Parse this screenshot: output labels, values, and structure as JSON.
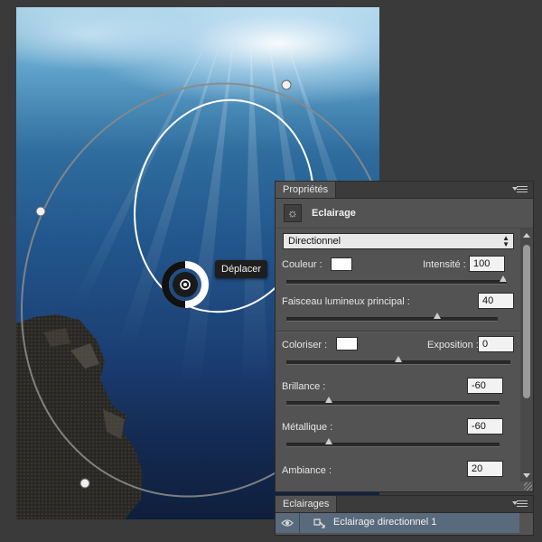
{
  "canvas": {
    "tooltip": "Déplacer"
  },
  "properties_panel": {
    "tab_label": "Propriétés",
    "header_icon": "sun-light-icon",
    "title": "Eclairage",
    "light_type": "Directionnel",
    "color_label": "Couleur :",
    "color_value": "#ffffff",
    "intensity_label": "Intensité :",
    "intensity_value": "100",
    "intensity_slider": 100,
    "hotspot_label": "Faisceau lumineux principal :",
    "hotspot_value": "40",
    "hotspot_slider": 40,
    "colorize_label": "Coloriser :",
    "colorize_value": "#ffffff",
    "exposure_label": "Exposition :",
    "exposure_value": "0",
    "exposure_slider": 0,
    "gloss_label": "Brillance :",
    "gloss_value": "-60",
    "gloss_slider": -60,
    "metallic_label": "Métallique :",
    "metallic_value": "-60",
    "metallic_slider": -60,
    "ambience_label": "Ambiance :",
    "ambience_value": "20"
  },
  "lights_panel": {
    "tab_label": "Eclairages",
    "items": [
      {
        "name": "Eclairage directionnel 1",
        "visible": true,
        "icon": "directional-light-icon"
      }
    ]
  },
  "colors": {
    "panel_bg": "#535353",
    "selected_row": "#5a6a7d",
    "workspace_bg": "#3a3a3a"
  }
}
